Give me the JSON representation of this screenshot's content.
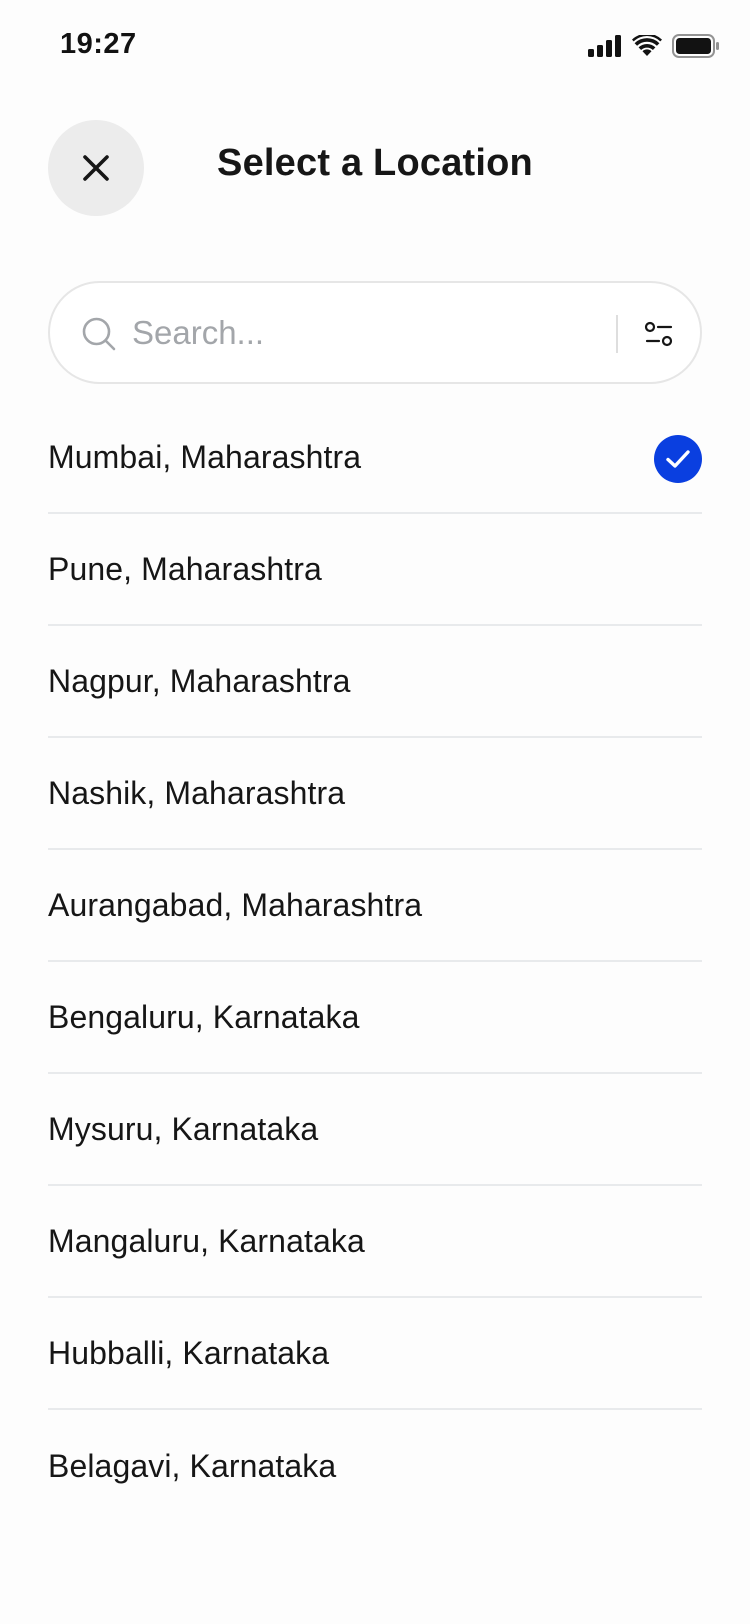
{
  "status_bar": {
    "time": "19:27",
    "icons": [
      "cellular-signal-icon",
      "wifi-icon",
      "battery-icon"
    ]
  },
  "header": {
    "title": "Select a Location",
    "close_icon": "close-icon"
  },
  "search": {
    "placeholder": "Search...",
    "value": "",
    "icon": "search-icon",
    "filter_icon": "filter-icon"
  },
  "locations": [
    {
      "label": "Mumbai, Maharashtra",
      "selected": true
    },
    {
      "label": "Pune, Maharashtra",
      "selected": false
    },
    {
      "label": "Nagpur, Maharashtra",
      "selected": false
    },
    {
      "label": "Nashik, Maharashtra",
      "selected": false
    },
    {
      "label": "Aurangabad, Maharashtra",
      "selected": false
    },
    {
      "label": "Bengaluru, Karnataka",
      "selected": false
    },
    {
      "label": "Mysuru, Karnataka",
      "selected": false
    },
    {
      "label": "Mangaluru, Karnataka",
      "selected": false
    },
    {
      "label": "Hubballi, Karnataka",
      "selected": false
    },
    {
      "label": "Belagavi, Karnataka",
      "selected": false
    }
  ],
  "colors": {
    "accent": "#0a3fe0",
    "close_button_bg": "#ececec",
    "divider": "#e8eaec",
    "placeholder": "#a3a6aa",
    "text": "#161616"
  }
}
